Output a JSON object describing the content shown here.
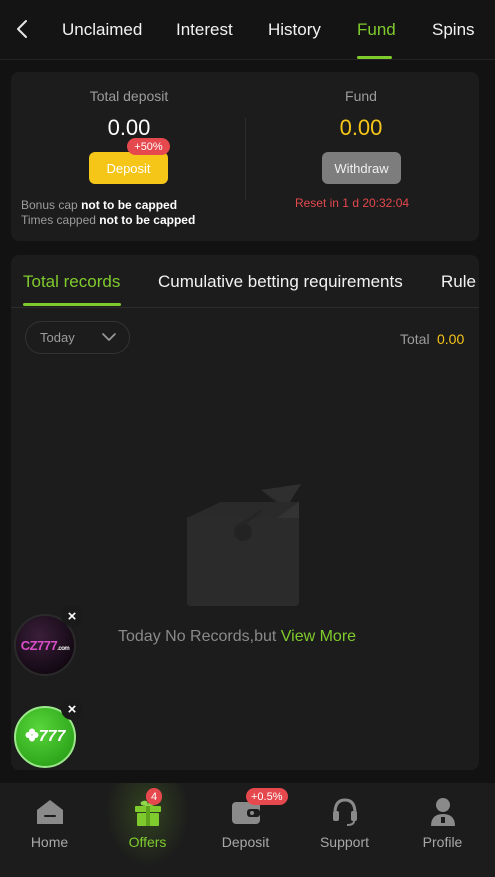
{
  "top_tabs": [
    {
      "label": "Unclaimed"
    },
    {
      "label": "Interest"
    },
    {
      "label": "History"
    },
    {
      "label": "Fund",
      "active": true
    },
    {
      "label": "Spins"
    }
  ],
  "summary": {
    "total_deposit_label": "Total deposit",
    "total_deposit_value": "0.00",
    "deposit_button": "Deposit",
    "deposit_badge": "+50%",
    "fund_label": "Fund",
    "fund_value": "0.00",
    "withdraw_button": "Withdraw",
    "bonus_cap_label": "Bonus cap",
    "bonus_cap_value": "not to be capped",
    "times_capped_label": "Times capped",
    "times_capped_value": "not to be capped",
    "reset_text": "Reset in 1 d 20:32:04"
  },
  "records": {
    "tabs": [
      {
        "label": "Total records",
        "active": true
      },
      {
        "label": "Cumulative betting requirements"
      },
      {
        "label": "Rule"
      }
    ],
    "date_filter": "Today",
    "total_label": "Total",
    "total_value": "0.00",
    "empty_text": "Today No Records,but",
    "view_more": "View More"
  },
  "floating": {
    "cz_logo": "CZ777",
    "cz_logo_suffix": ".com",
    "green_logo": "777",
    "close_glyph": "×"
  },
  "bottom_nav": [
    {
      "label": "Home",
      "icon": "home-icon"
    },
    {
      "label": "Offers",
      "icon": "gift-icon",
      "active": true,
      "badge": "4"
    },
    {
      "label": "Deposit",
      "icon": "wallet-icon",
      "badge": "+0.5%"
    },
    {
      "label": "Support",
      "icon": "headset-icon"
    },
    {
      "label": "Profile",
      "icon": "user-icon"
    }
  ],
  "colors": {
    "accent_green": "#7fcb2d",
    "gold": "#f5c518",
    "alert_red": "#e5484d",
    "background": "#121212",
    "card": "#1c1c1c"
  }
}
